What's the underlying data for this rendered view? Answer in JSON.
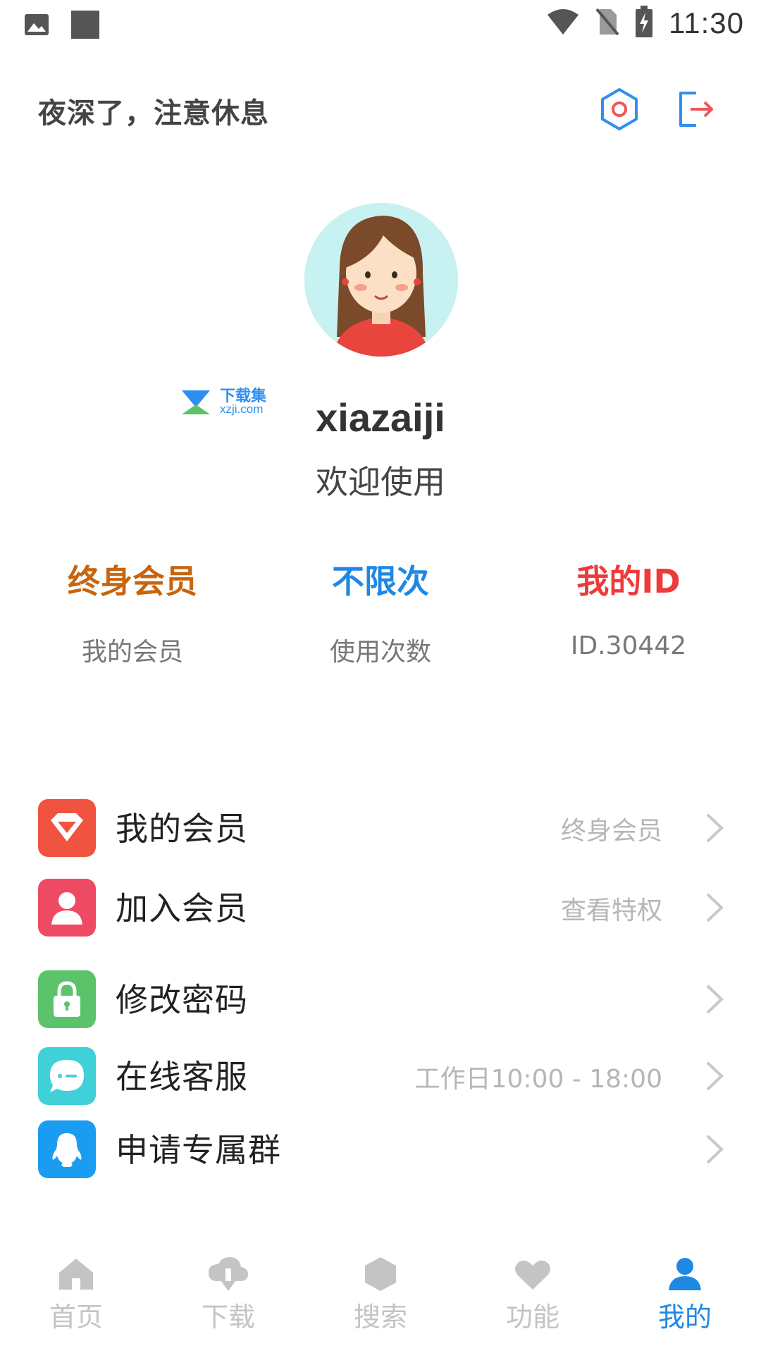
{
  "status_bar": {
    "time": "11:30",
    "icons": [
      "image-icon",
      "square-icon",
      "wifi-icon",
      "no-sim-icon",
      "battery-charging-icon"
    ]
  },
  "header": {
    "greeting": "夜深了，注意休息",
    "settings_icon": "gear-icon",
    "logout_icon": "logout-icon"
  },
  "profile": {
    "username": "xiazaiji",
    "welcome": "欢迎使用",
    "watermark_top": "下载集",
    "watermark_bottom": "xzji.com"
  },
  "stats": [
    {
      "value": "终身会员",
      "label": "我的会员",
      "color": "#c7650f"
    },
    {
      "value": "不限次",
      "label": "使用次数",
      "color": "#1e88e5"
    },
    {
      "value": "我的ID",
      "label": "ID.30442",
      "color": "#ee3a3a"
    }
  ],
  "menu": [
    {
      "label": "我的会员",
      "right": "终身会员",
      "icon": "diamond-icon",
      "color": "#f0533f"
    },
    {
      "label": "加入会员",
      "right": "查看特权",
      "icon": "user-icon",
      "color": "#ef4a63"
    },
    {
      "label": "修改密码",
      "right": "",
      "icon": "lock-icon",
      "color": "#5cc36b"
    },
    {
      "label": "在线客服",
      "right": "工作日10:00 - 18:00",
      "icon": "chat-icon",
      "color": "#3fd0d8"
    },
    {
      "label": "申请专属群",
      "right": "",
      "icon": "qq-icon",
      "color": "#1a9cf0"
    }
  ],
  "nav": [
    {
      "label": "首页",
      "icon": "home-icon",
      "active": false
    },
    {
      "label": "下载",
      "icon": "cloud-download-icon",
      "active": false
    },
    {
      "label": "搜索",
      "icon": "hexagon-icon",
      "active": false
    },
    {
      "label": "功能",
      "icon": "heart-icon",
      "active": false
    },
    {
      "label": "我的",
      "icon": "person-icon",
      "active": true
    }
  ],
  "colors": {
    "accent": "#1e88e5",
    "inactive": "#c4c4c4"
  }
}
